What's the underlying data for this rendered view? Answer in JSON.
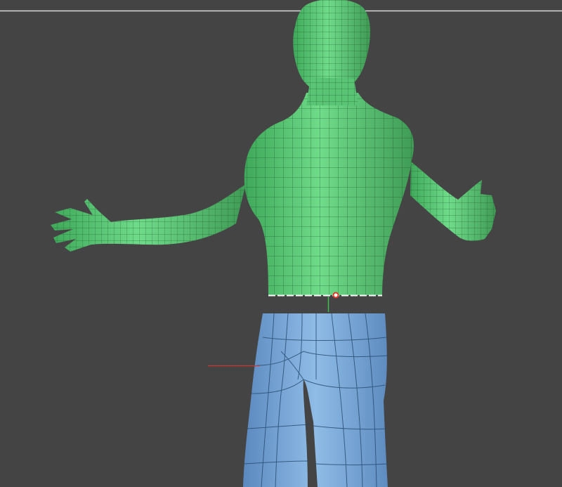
{
  "viewport": {
    "background": "#444444",
    "frame_line_color": "#d9d9d9"
  },
  "objects": [
    {
      "name": "upper-body-mesh",
      "color": "#59c776",
      "wire_color": "#1f4f2a",
      "selected": true
    },
    {
      "name": "legs-mesh",
      "color": "#7aa8d6",
      "wire_color": "#25496e",
      "selected": false
    }
  ],
  "gizmo": {
    "pivot_color": "#e03a2a",
    "x_axis_color": "#c83a3a",
    "y_axis_color": "#3fbf4f"
  }
}
